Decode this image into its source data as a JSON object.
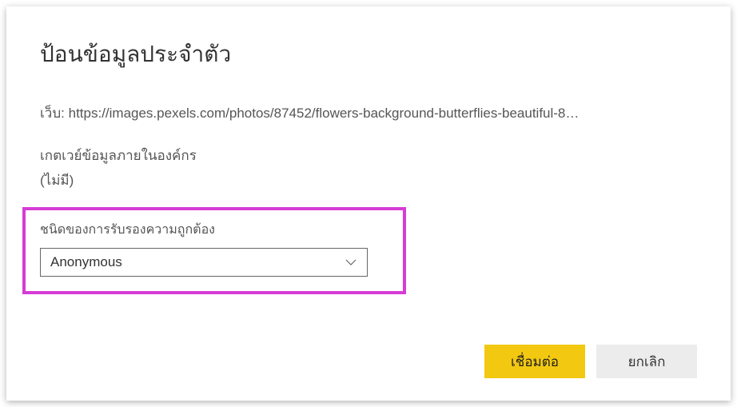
{
  "dialog": {
    "title": "ป้อนข้อมูลประจำตัว",
    "web_prefix": "เว็บ:",
    "web_url": "https://images.pexels.com/photos/87452/flowers-background-butterflies-beautiful-8…",
    "gateway_label": "เกตเวย์ข้อมูลภายในองค์กร",
    "gateway_value": "(ไม่มี)",
    "auth_type_label": "ชนิดของการรับรองความถูกต้อง",
    "auth_type_value": "Anonymous",
    "connect_button": "เชื่อมต่อ",
    "cancel_button": "ยกเลิก"
  },
  "colors": {
    "highlight": "#d63cd6",
    "primary_button": "#f2c811"
  }
}
